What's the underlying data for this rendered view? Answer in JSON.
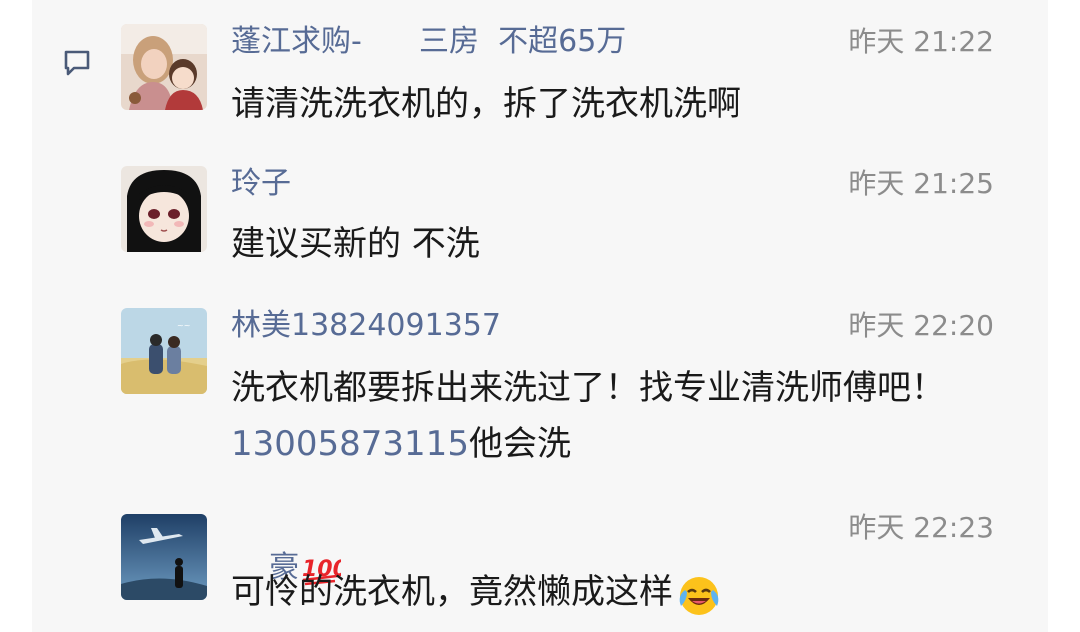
{
  "comments": [
    {
      "name": "蓬江求购-      三房  不超65万",
      "time": "昨天 21:22",
      "text": "请清洗洗衣机的，拆了洗衣机洗啊",
      "avatar_icon": "mother-and-child-photo"
    },
    {
      "name": "玲子",
      "time": "昨天 21:25",
      "text": "建议买新的 不洗",
      "avatar_icon": "anime-girl-avatar"
    },
    {
      "name": "林美13824091357",
      "time": "昨天 22:20",
      "text_before": "洗衣机都要拆出来洗过了！找专业清洗师傅吧！",
      "phone": "13005873115",
      "text_after": "他会洗",
      "avatar_icon": "illustrated-couple-avatar"
    },
    {
      "name": "豪",
      "name_emoji": "hundred-points-emoji",
      "time": "昨天 22:23",
      "text": "可怜的洗衣机，竟然懒成这样",
      "text_emoji": "crying-laughing-emoji",
      "avatar_icon": "sky-airplane-avatar"
    }
  ],
  "colors": {
    "name": "#576b95",
    "time": "#8c8c8c",
    "text": "#1a1a1a",
    "background": "#f7f7f7"
  }
}
